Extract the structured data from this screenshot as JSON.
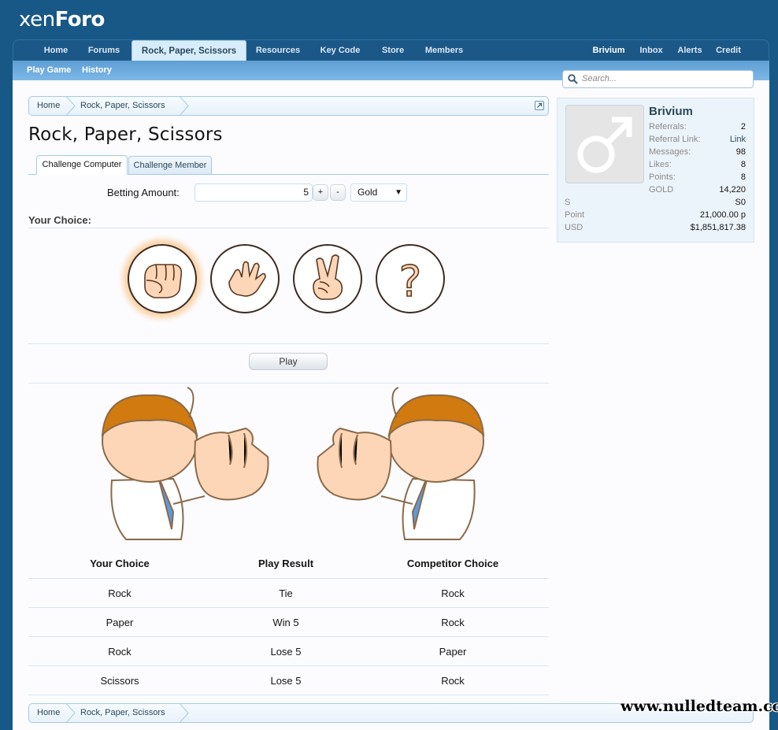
{
  "app": {
    "logo_part1": "xen",
    "logo_part2": "Foro"
  },
  "nav": {
    "tabs": [
      {
        "label": "Home"
      },
      {
        "label": "Forums"
      },
      {
        "label": "Rock, Paper, Scissors"
      },
      {
        "label": "Resources"
      },
      {
        "label": "Key Code"
      },
      {
        "label": "Store"
      },
      {
        "label": "Members"
      }
    ],
    "selected_tab": "Rock, Paper, Scissors",
    "right": [
      {
        "label": "Brivium"
      },
      {
        "label": "Inbox"
      },
      {
        "label": "Alerts"
      },
      {
        "label": "Credit"
      }
    ]
  },
  "subnav": [
    {
      "label": "Play Game"
    },
    {
      "label": "History"
    }
  ],
  "search": {
    "placeholder": "Search..."
  },
  "breadcrumb": [
    {
      "label": "Home"
    },
    {
      "label": "Rock, Paper, Scissors"
    }
  ],
  "page_title": "Rock, Paper, Scissors",
  "content_tabs": [
    {
      "label": "Challenge Computer"
    },
    {
      "label": "Challenge Member"
    }
  ],
  "active_content_tab": "Challenge Computer",
  "betting": {
    "label": "Betting Amount:",
    "value": "5",
    "plus": "+",
    "minus": "-",
    "currency": "Gold"
  },
  "your_choice_label": "Your Choice:",
  "choices": [
    {
      "name": "Rock",
      "icon": "fist-icon",
      "selected": true
    },
    {
      "name": "Paper",
      "icon": "open-hand-icon",
      "selected": false
    },
    {
      "name": "Scissors",
      "icon": "victory-hand-icon",
      "selected": false
    },
    {
      "name": "Random",
      "icon": "question-mark-icon",
      "selected": false
    }
  ],
  "play_button": "Play",
  "results": {
    "headers": [
      "Your Choice",
      "Play Result",
      "Competitor Choice"
    ],
    "rows": [
      [
        "Rock",
        "Tie",
        "Rock"
      ],
      [
        "Paper",
        "Win 5",
        "Rock"
      ],
      [
        "Rock",
        "Lose 5",
        "Paper"
      ],
      [
        "Scissors",
        "Lose 5",
        "Rock"
      ]
    ]
  },
  "profile": {
    "name": "Brivium",
    "stats": [
      {
        "label": "Referrals:",
        "value": "2"
      },
      {
        "label": "Referral Link:",
        "value": "Link"
      },
      {
        "label": "Messages:",
        "value": "98"
      },
      {
        "label": "Likes:",
        "value": "8"
      },
      {
        "label": "Points:",
        "value": "8"
      },
      {
        "label": "GOLD",
        "value": "14,220"
      }
    ],
    "currencies": [
      {
        "label": "S",
        "value": "S0"
      },
      {
        "label": "Point",
        "value": "21,000.00 p"
      },
      {
        "label": "USD",
        "value": "$1,851,817.38"
      }
    ]
  },
  "colors": {
    "header": "#185886",
    "accent": "#2b485c",
    "skin": "#fcd6b6",
    "hair": "#d07a0f",
    "tie": "#5b9be0"
  },
  "watermark": "www.nulledteam.com"
}
